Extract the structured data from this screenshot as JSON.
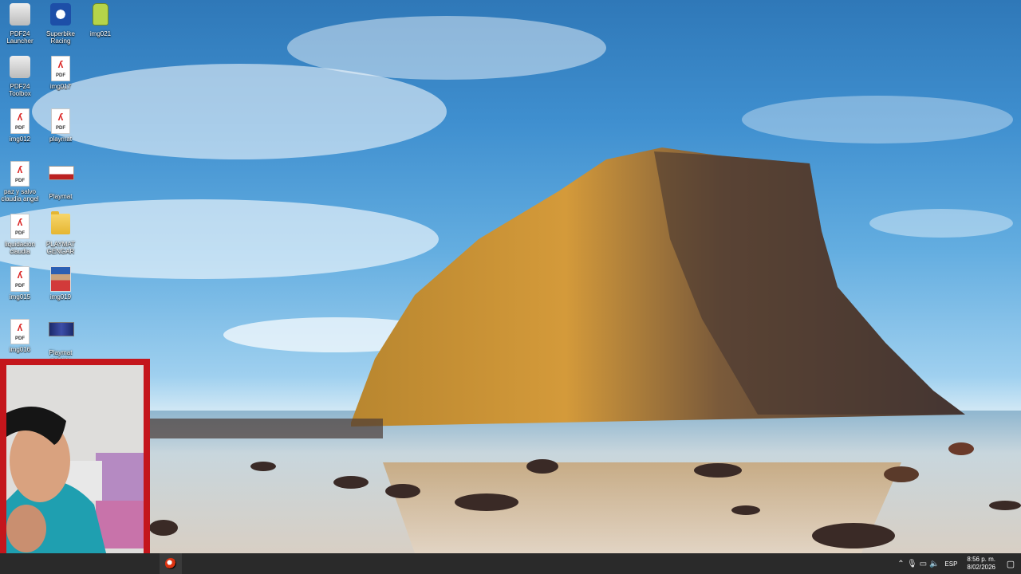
{
  "desktop": {
    "icons": [
      {
        "name": "pdf24-launcher-icon",
        "label": "PDF24 Launcher",
        "kind": "app"
      },
      {
        "name": "superbike-racing-icon",
        "label": "Superbike Racing",
        "kind": "game"
      },
      {
        "name": "img021-icon",
        "label": "img021",
        "kind": "android"
      },
      {
        "name": "pdf24-toolbox-icon",
        "label": "PDF24 Toolbox",
        "kind": "app"
      },
      {
        "name": "img017-icon",
        "label": "img017",
        "kind": "pdf"
      },
      {
        "name": "img012-icon",
        "label": "img012",
        "kind": "pdf"
      },
      {
        "name": "playmat-pdf-icon",
        "label": "playmat",
        "kind": "pdf"
      },
      {
        "name": "paz-y-salvo-icon",
        "label": "paz y salvo claudia angel",
        "kind": "pdf"
      },
      {
        "name": "playmat-bed-icon",
        "label": "Playmat",
        "kind": "bed"
      },
      {
        "name": "liquidacion-icon",
        "label": "liquidacion claudia",
        "kind": "pdf"
      },
      {
        "name": "playmat-gengar-folder-icon",
        "label": "PLAYMAT GENGAR",
        "kind": "folder"
      },
      {
        "name": "img015-icon",
        "label": "img015",
        "kind": "pdf"
      },
      {
        "name": "img019-icon",
        "label": "img019",
        "kind": "photo"
      },
      {
        "name": "img016-icon",
        "label": "img016",
        "kind": "pdf"
      },
      {
        "name": "playmat-gengar-image-icon",
        "label": "Playmat gengar",
        "kind": "thumb"
      }
    ]
  },
  "taskbar": {
    "tray_icons": [
      "chevron-up-icon",
      "microphone-icon",
      "network-icon",
      "volume-icon"
    ],
    "language": "ESP",
    "time": "8:56 p. m.",
    "date": "8/02/2026"
  },
  "colors": {
    "taskbar": "#2a2a2a",
    "webcam_frame": "#c4161c"
  }
}
